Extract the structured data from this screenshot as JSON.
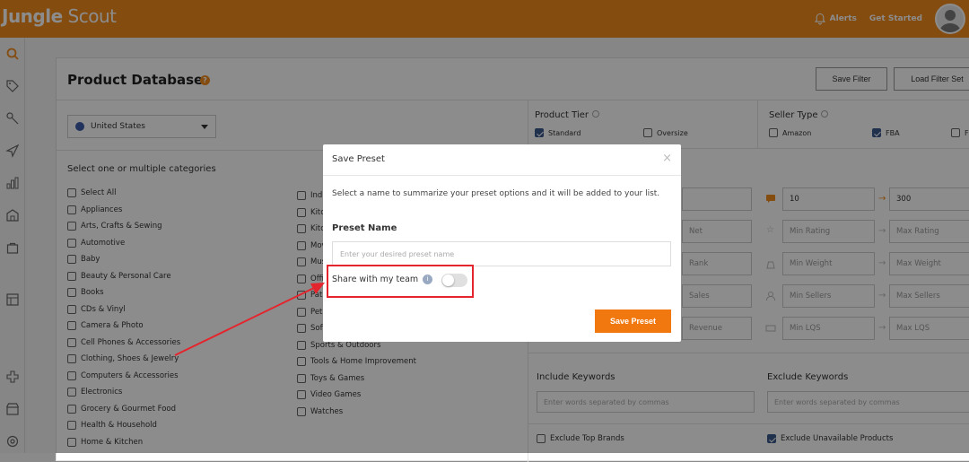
{
  "app": {
    "logo_bold": "Jungle",
    "logo_rest": " Scout",
    "alerts_label": "Alerts",
    "get_started_label": "Get Started"
  },
  "sidebar": {
    "icons": [
      "search-icon",
      "tag-icon",
      "key-icon",
      "rocket-icon",
      "bar-chart-icon",
      "building-icon",
      "bag-icon",
      "layout-icon",
      "plus-icon",
      "store-icon",
      "settings-icon"
    ]
  },
  "page": {
    "title": "Product Database",
    "save_filter_label": "Save Filter",
    "load_filter_label": "Load Filter Set",
    "marketplace": "United States",
    "categories_heading": "Select one or multiple categories",
    "categories_col1": [
      "Select All",
      "Appliances",
      "Arts, Crafts & Sewing",
      "Automotive",
      "Baby",
      "Beauty & Personal Care",
      "Books",
      "CDs & Vinyl",
      "Camera & Photo",
      "Cell Phones & Accessories",
      "Clothing, Shoes & Jewelry",
      "Computers & Accessories",
      "Electronics",
      "Grocery & Gourmet Food",
      "Health & Household",
      "Home & Kitchen"
    ],
    "categories_col2": [
      "Indu",
      "Kitc",
      "Kitc",
      "Mov",
      "Mus",
      "Offi",
      "Pati",
      "Pet",
      "Software",
      "Sports & Outdoors",
      "Tools & Home Improvement",
      "Toys & Games",
      "Video Games",
      "Watches"
    ],
    "product_tier_label": "Product Tier",
    "tier_standard": "Standard",
    "tier_oversize": "Oversize",
    "seller_type_label": "Seller Type",
    "seller_amazon": "Amazon",
    "seller_fba": "FBA",
    "seller_fbm": "F",
    "filters": {
      "reviews_min": "10",
      "reviews_max": "300",
      "net_label": "Net",
      "rank_label": "Rank",
      "sales_label": "Sales",
      "revenue_label": "Revenue",
      "min_rating": "Min Rating",
      "max_rating": "Max Rating",
      "min_weight": "Min Weight",
      "max_weight": "Max Weight",
      "min_sellers": "Min Sellers",
      "max_sellers": "Max Sellers",
      "min_lqs": "Min LQS",
      "max_lqs": "Max LQS"
    },
    "include_keywords_label": "Include Keywords",
    "include_keywords_placeholder": "Enter words separated by commas",
    "exclude_keywords_label": "Exclude Keywords",
    "exclude_keywords_placeholder": "Enter words separated by commas",
    "exclude_top_brands": "Exclude Top Brands",
    "exclude_unavailable": "Exclude Unavailable Products"
  },
  "modal": {
    "title": "Save Preset",
    "close_glyph": "×",
    "description": "Select a name to summarize your preset options and it will be added to your list.",
    "preset_name_label": "Preset Name",
    "preset_name_placeholder": "Enter your desired preset name",
    "share_label": "Share with my team",
    "info_glyph": "i",
    "share_enabled": false,
    "save_button": "Save Preset"
  },
  "colors": {
    "brand": "#f18a1d",
    "save_button": "#f1780f",
    "highlight": "#e4252d"
  }
}
